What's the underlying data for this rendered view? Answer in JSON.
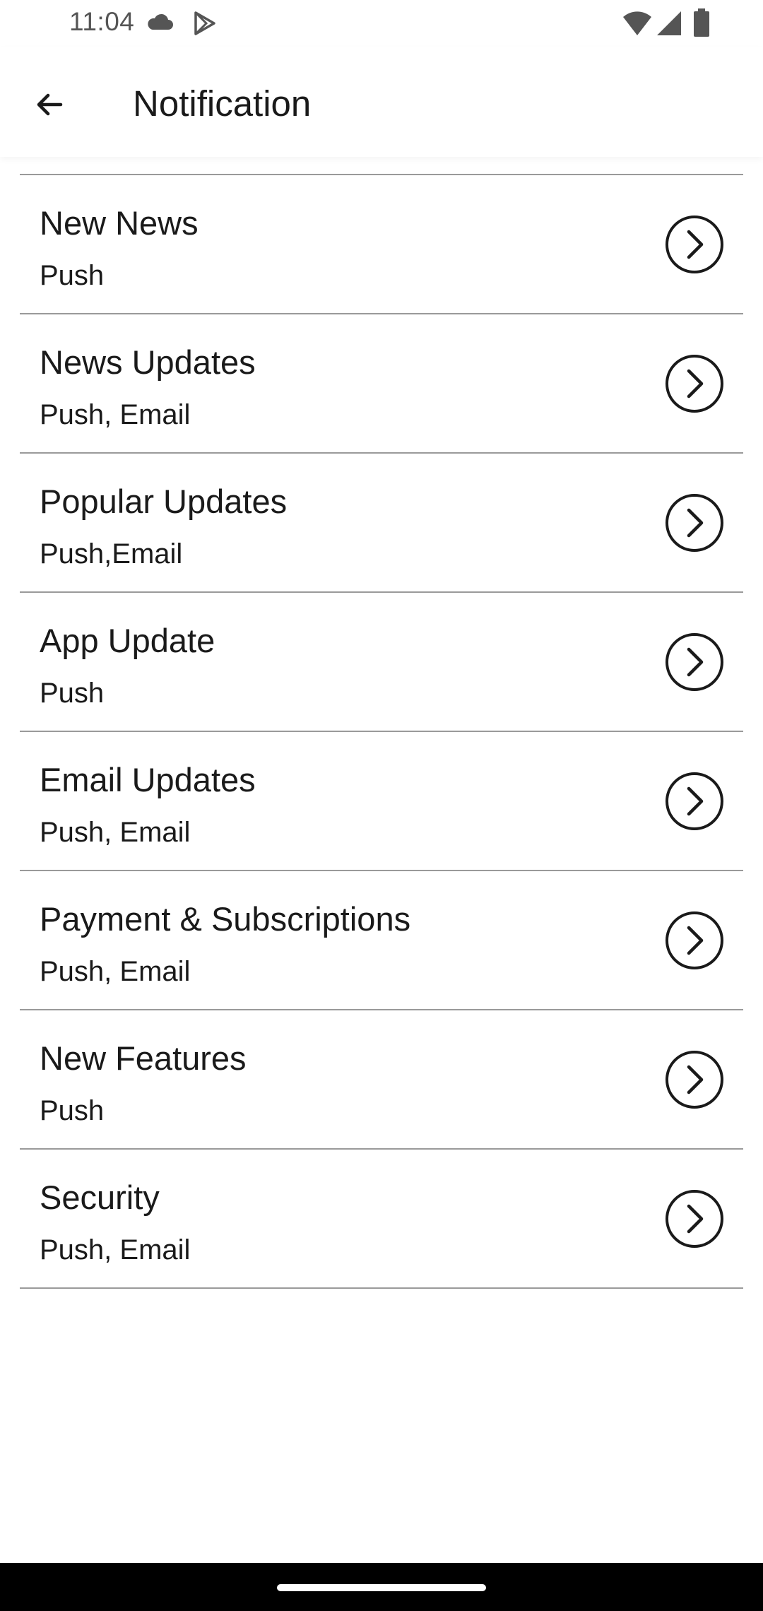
{
  "status_bar": {
    "time": "11:04",
    "icons": [
      "cloud-icon",
      "play-store-icon",
      "wifi-icon",
      "signal-icon",
      "battery-icon"
    ]
  },
  "app_bar": {
    "back_icon": "arrow-left-icon",
    "title": "Notification"
  },
  "items": [
    {
      "title": "New News",
      "channels": "Push"
    },
    {
      "title": "News Updates",
      "channels": "Push, Email"
    },
    {
      "title": "Popular Updates",
      "channels": "Push,Email"
    },
    {
      "title": "App Update",
      "channels": "Push"
    },
    {
      "title": "Email Updates",
      "channels": "Push, Email"
    },
    {
      "title": "Payment & Subscriptions",
      "channels": "Push, Email"
    },
    {
      "title": "New Features",
      "channels": "Push"
    },
    {
      "title": "Security",
      "channels": "Push, Email"
    }
  ],
  "item_icon": "chevron-right-circle-icon",
  "colors": {
    "background": "#ffffff",
    "text": "#1a1a1a",
    "divider": "#9a9a9a",
    "status_text": "#555555",
    "nav_bar": "#000000"
  }
}
